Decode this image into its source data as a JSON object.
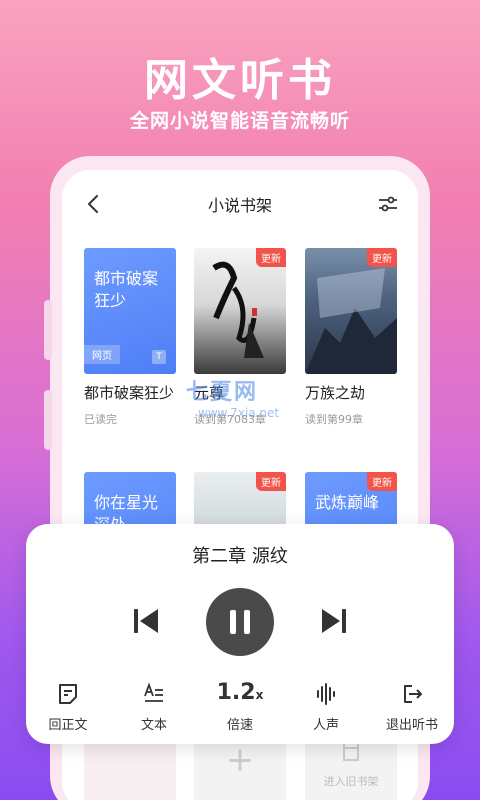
{
  "hero": {
    "title": "网文听书",
    "subtitle": "全网小说智能语音流畅听"
  },
  "nav": {
    "title": "小说书架"
  },
  "badge_label": "更新",
  "books_row1": [
    {
      "title": "都市破案狂少",
      "cover_title": "都市破案狂少",
      "cover_tag": "网页",
      "cover_icon": "T",
      "status": "已读完",
      "badge": false
    },
    {
      "title": "元尊",
      "status": "读到第7083章",
      "badge": true
    },
    {
      "title": "万族之劫",
      "status": "读到第99章",
      "badge": true
    }
  ],
  "books_row2": [
    {
      "cover_title": "你在星光深处"
    },
    {
      "badge": true
    },
    {
      "cover_title": "武炼巅峰",
      "badge": true
    }
  ],
  "watermark": {
    "main": "七夏网",
    "sub": "www.7xia.net"
  },
  "player": {
    "chapter": "第二章 源纹",
    "tools": [
      {
        "label": "回正文",
        "icon": "note-icon"
      },
      {
        "label": "文本",
        "icon": "text-icon"
      },
      {
        "label": "倍速",
        "value": "1.2",
        "unit": "x"
      },
      {
        "label": "人声",
        "icon": "voice-wave-icon"
      },
      {
        "label": "退出听书",
        "icon": "exit-icon"
      }
    ]
  },
  "bottom": {
    "import_label": "进入旧书架",
    "add_symbol": "+"
  },
  "colors": {
    "accent_red": "#f2534a",
    "cover_blue": "#5a87fa",
    "pause_bg": "#4a4a4a"
  }
}
